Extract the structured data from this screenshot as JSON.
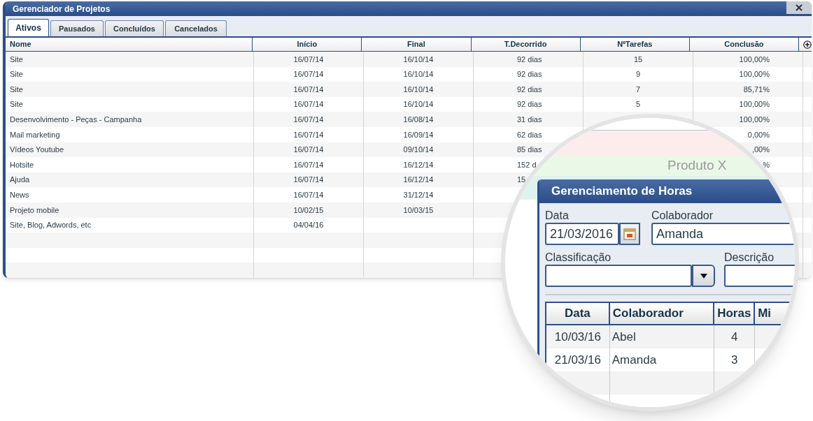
{
  "window": {
    "title": "Gerenciador de Projetos"
  },
  "tabs": [
    {
      "label": "Ativos",
      "selected": true
    },
    {
      "label": "Pausados",
      "selected": false
    },
    {
      "label": "Concluídos",
      "selected": false
    },
    {
      "label": "Cancelados",
      "selected": false
    }
  ],
  "table": {
    "columns": [
      "Nome",
      "Início",
      "Final",
      "T.Decorrido",
      "NºTarefas",
      "Conclusão"
    ],
    "rows": [
      {
        "name": "Site",
        "start": "16/07/14",
        "end": "16/10/14",
        "elapsed": "92 dias",
        "tasks": "15",
        "completion": "100,00%"
      },
      {
        "name": "Site",
        "start": "16/07/14",
        "end": "16/10/14",
        "elapsed": "92 dias",
        "tasks": "9",
        "completion": "100,00%"
      },
      {
        "name": "Site",
        "start": "16/07/14",
        "end": "16/10/14",
        "elapsed": "92 dias",
        "tasks": "7",
        "completion": "85,71%"
      },
      {
        "name": "Site",
        "start": "16/07/14",
        "end": "16/10/14",
        "elapsed": "92 dias",
        "tasks": "5",
        "completion": "100,00%"
      },
      {
        "name": "Desenvolvimento - Peças - Campanha",
        "start": "16/07/14",
        "end": "16/08/14",
        "elapsed": "31 dias",
        "completion": "100,00%"
      },
      {
        "name": "Mail marketing",
        "start": "16/07/14",
        "end": "16/09/14",
        "elapsed": "62 dias",
        "completion": "0,00%"
      },
      {
        "name": "Vídeos Youtube",
        "start": "16/07/14",
        "end": "09/10/14",
        "elapsed": "85 dias",
        "completion": ",00%"
      },
      {
        "name": "Hotsite",
        "start": "16/07/14",
        "end": "16/12/14",
        "elapsed": "152 d",
        "completion": "%"
      },
      {
        "name": "Ajuda",
        "start": "16/07/14",
        "end": "16/12/14",
        "elapsed": "15"
      },
      {
        "name": "News",
        "start": "16/07/14",
        "end": "31/12/14"
      },
      {
        "name": "Projeto mobile",
        "start": "10/02/15",
        "end": "10/03/15"
      },
      {
        "name": "Site, Blog, Adwords, etc",
        "start": "04/04/16"
      }
    ]
  },
  "magnifier": {
    "band_label": "Produto X",
    "dialog": {
      "title": "Gerenciamento de Horas",
      "fields": [
        {
          "label": "Data",
          "value": "21/03/2016",
          "kind": "date"
        },
        {
          "label": "Colaborador",
          "value": "Amanda",
          "kind": "text"
        },
        {
          "label": "Classificação",
          "kind": "select"
        },
        {
          "label": "Descrição",
          "kind": "text"
        }
      ],
      "table": {
        "columns": [
          "Data",
          "Colaborador",
          "Horas",
          "Mi"
        ],
        "rows": [
          [
            "10/03/16",
            "Abel",
            "4"
          ],
          [
            "21/03/16",
            "Amanda",
            "3"
          ]
        ]
      }
    }
  }
}
